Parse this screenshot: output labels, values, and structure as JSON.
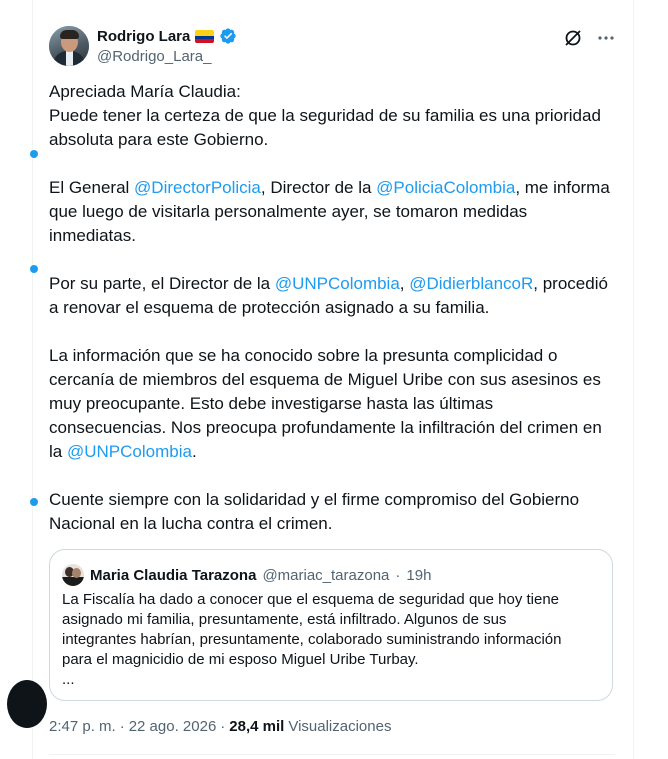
{
  "author": {
    "name": "Rodrigo Lara",
    "handle": "@Rodrigo_Lara_",
    "flag_icon": "colombia-flag-icon",
    "verified_icon": "verified-badge-icon",
    "verified_color": "#1d9bf0"
  },
  "header_actions": {
    "grok_icon": "grok-icon",
    "more_icon": "more-icon"
  },
  "tweet": {
    "p1_l1": "Apreciada María Claudia:",
    "p1_l2": "Puede tener la certeza de que la seguridad de su familia es una prioridad absoluta para este Gobierno.",
    "p2_a": "El General ",
    "p2_m1": "@DirectorPolicia",
    "p2_b": ", Director de la ",
    "p2_m2": "@PoliciaColombia",
    "p2_c": ", me informa que luego de visitarla personalmente ayer, se tomaron medidas inmediatas.",
    "p3_a": "Por su parte, el Director de la ",
    "p3_m1": "@UNPColombia",
    "p3_b": ", ",
    "p3_m2": "@DidierblancoR",
    "p3_c": ", procedió a renovar el esquema de protección asignado a su familia.",
    "p4_a": "La información que se ha conocido sobre la presunta complicidad o cercanía de miembros del esquema de Miguel Uribe con sus asesinos es muy preocupante. Esto debe investigarse hasta las últimas consecuencias. Nos preocupa profundamente la infiltración del crimen en la ",
    "p4_m1": "@UNPColombia",
    "p4_b": ".",
    "p5": "Cuente siempre con la solidaridad y el firme compromiso del Gobierno Nacional en la lucha contra el crimen."
  },
  "quote": {
    "name": "Maria Claudia Tarazona",
    "handle": "@mariac_tarazona",
    "dot": "·",
    "time": "19h",
    "text_l1": "La Fiscalía ha dado a conocer que el esquema de seguridad que hoy tiene",
    "text_l2": "asignado mi familia, presuntamente, está infiltrado. Algunos de sus",
    "text_l3": "integrantes habrían, presuntamente, colaborado suministrando información",
    "text_l4": "para el magnicidio de mi esposo Miguel Uribe Turbay.",
    "text_l5": "..."
  },
  "meta": {
    "time": "2:47 p. m.",
    "dot1": "·",
    "date": "22 ago. 2026",
    "dot2": "·",
    "views_count": "28,4 mil",
    "views_label": "Visualizaciones"
  },
  "colors": {
    "accent": "#1d9bf0",
    "text": "#0f1419",
    "secondary": "#536471",
    "border": "#cfd9de"
  }
}
